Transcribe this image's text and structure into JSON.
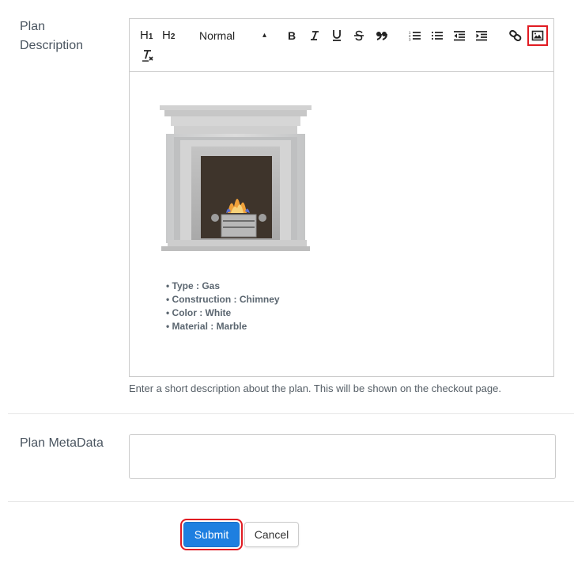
{
  "plan_description": {
    "label": "Plan\nDescription",
    "label_line1": "Plan",
    "label_line2": "Description",
    "toolbar": {
      "h1": "H",
      "h1_sub": "1",
      "h2": "H",
      "h2_sub": "2",
      "format_select": "Normal",
      "buttons": [
        "bold",
        "italic",
        "underline",
        "strike",
        "blockquote",
        "ordered-list",
        "bullet-list",
        "indent-decrease",
        "indent-increase",
        "link",
        "image",
        "clean"
      ]
    },
    "content": {
      "image_alt": "Fireplace",
      "features": [
        "Type : Gas",
        "Construction : Chimney",
        "Color : White",
        "Material : Marble"
      ]
    },
    "help_text": "Enter a short description about the plan. This will be shown on the checkout page."
  },
  "plan_metadata": {
    "label": "Plan MetaData",
    "value": ""
  },
  "actions": {
    "submit_label": "Submit",
    "cancel_label": "Cancel"
  },
  "colors": {
    "primary": "#1e7fe0",
    "highlight": "#e11b22"
  }
}
